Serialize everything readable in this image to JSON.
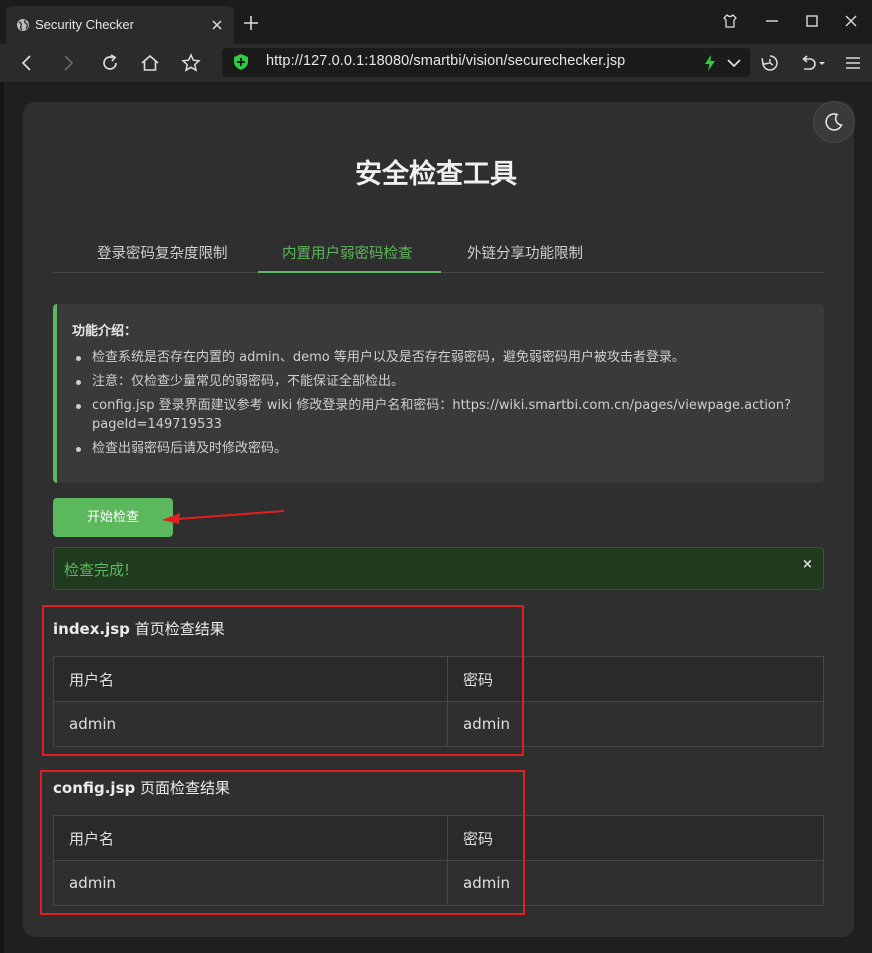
{
  "browser": {
    "tab_title": "Security Checker",
    "url": "http://127.0.0.1:18080/smartbi/vision/securechecker.jsp"
  },
  "page": {
    "title": "安全检查工具",
    "tabs": [
      {
        "label": "登录密码复杂度限制",
        "active": false
      },
      {
        "label": "内置用户弱密码检查",
        "active": true
      },
      {
        "label": "外链分享功能限制",
        "active": false
      }
    ],
    "info": {
      "heading": "功能介绍：",
      "items": [
        "检查系统是否存在内置的 admin、demo 等用户以及是否存在弱密码，避免弱密码用户被攻击者登录。",
        "注意：仅检查少量常见的弱密码，不能保证全部检出。",
        "config.jsp 登录界面建议参考 wiki 修改登录的用户名和密码：https://wiki.smartbi.com.cn/pages/viewpage.action?pageId=149719533",
        "检查出弱密码后请及时修改密码。"
      ]
    },
    "start_button": "开始检查",
    "alert": {
      "text": "检查完成!",
      "close": "×"
    },
    "sections": [
      {
        "title_bold": "index.jsp",
        "title_rest": " 首页检查结果",
        "headers": [
          "用户名",
          "密码"
        ],
        "rows": [
          [
            "admin",
            "admin"
          ]
        ]
      },
      {
        "title_bold": "config.jsp",
        "title_rest": " 页面检查结果",
        "headers": [
          "用户名",
          "密码"
        ],
        "rows": [
          [
            "admin",
            "admin"
          ]
        ]
      }
    ]
  },
  "colors": {
    "accent": "#5cb85c",
    "annotation_red": "#e02020"
  }
}
